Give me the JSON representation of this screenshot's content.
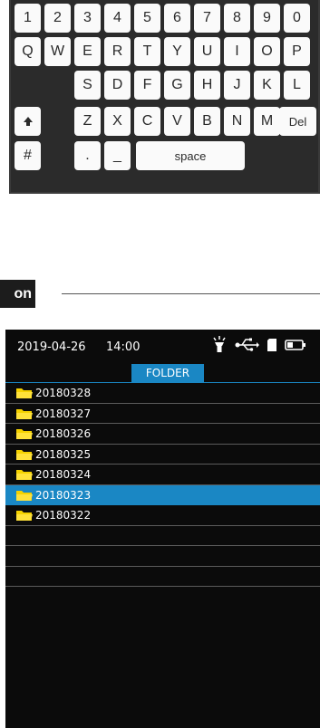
{
  "keyboard": {
    "row1": [
      "1",
      "2",
      "3",
      "4",
      "5",
      "6",
      "7",
      "8",
      "9",
      "0"
    ],
    "row2": [
      "Q",
      "W",
      "E",
      "R",
      "T",
      "Y",
      "U",
      "I",
      "O",
      "P"
    ],
    "row3": [
      "S",
      "D",
      "F",
      "G",
      "H",
      "J",
      "K",
      "L"
    ],
    "row4": [
      "Z",
      "X",
      "C",
      "V",
      "B",
      "N",
      "M"
    ],
    "del_label": "Del",
    "hash_label": "#",
    "dot_label": ".",
    "underscore_label": "_",
    "space_label": "space",
    "shift_icon": "shift-arrow-up-icon"
  },
  "section": {
    "tag_text": "on"
  },
  "screen": {
    "status": {
      "date": "2019-04-26",
      "time": "14:00",
      "icons": [
        "flashlight-icon",
        "usb-icon",
        "sd-card-icon",
        "battery-icon"
      ]
    },
    "tab_label": "FOLDER",
    "accent_color": "#1a87c4",
    "folder_icon_color": "#f5d200",
    "folders": [
      {
        "name": "20180328",
        "selected": false
      },
      {
        "name": "20180327",
        "selected": false
      },
      {
        "name": "20180326",
        "selected": false
      },
      {
        "name": "20180325",
        "selected": false
      },
      {
        "name": "20180324",
        "selected": false
      },
      {
        "name": "20180323",
        "selected": true
      },
      {
        "name": "20180322",
        "selected": false
      }
    ]
  }
}
